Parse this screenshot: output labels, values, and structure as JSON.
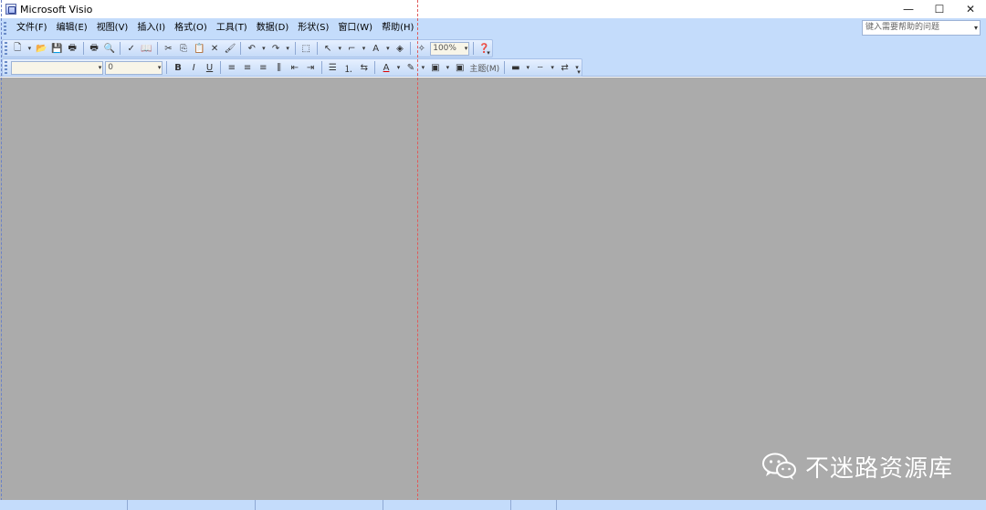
{
  "window": {
    "title": "Microsoft Visio",
    "controls": {
      "minimize": "—",
      "maximize": "☐",
      "close": "✕"
    }
  },
  "menubar": {
    "items": [
      {
        "label": "文件(F)"
      },
      {
        "label": "编辑(E)"
      },
      {
        "label": "视图(V)"
      },
      {
        "label": "插入(I)"
      },
      {
        "label": "格式(O)"
      },
      {
        "label": "工具(T)"
      },
      {
        "label": "数据(D)"
      },
      {
        "label": "形状(S)"
      },
      {
        "label": "窗口(W)"
      },
      {
        "label": "帮助(H)"
      }
    ],
    "help_search": {
      "placeholder": "键入需要帮助的问题",
      "arrow": "▾"
    }
  },
  "toolbar_standard": {
    "icons": [
      "new-icon",
      "open-icon",
      "save-icon",
      "print-icon",
      "print-preview-icon",
      "spelling-icon",
      "research-icon",
      "cut-icon",
      "copy-icon",
      "paste-icon",
      "delete-icon",
      "format-painter-icon",
      "undo-icon",
      "redo-icon",
      "shapes-icon",
      "pointer-tool-icon",
      "connector-tool-icon",
      "text-tool-icon",
      "stencil-icon",
      "connection-point-icon",
      "help-icon"
    ],
    "glyphs": {
      "new": "🗋",
      "open": "📂",
      "save": "💾",
      "print": "🖶",
      "preview": "🔍",
      "spell": "✓",
      "research": "📖",
      "cut": "✂",
      "copy": "⎘",
      "paste": "📋",
      "delete": "✕",
      "painter": "🖌",
      "undo": "↶",
      "redo": "↷",
      "shapes": "⬚",
      "pointer": "↖",
      "connector": "⌐",
      "text": "A",
      "stencil": "◈",
      "connpoint": "✧",
      "help": "❓",
      "dropdown": "▾"
    },
    "zoom_value": "100%"
  },
  "toolbar_formatting": {
    "font_value": "",
    "size_value": "0",
    "glyphs": {
      "bold": "B",
      "italic": "I",
      "underline": "U",
      "align_left": "≡",
      "align_center": "≡",
      "align_right": "≡",
      "justify": "⫼",
      "indent_dec": "⇤",
      "indent_inc": "⇥",
      "bullets": "☰",
      "num_list": "⒈",
      "dec_list": "⇆",
      "font_color": "A",
      "line_color": "✎",
      "fill_color": "▣",
      "line_weight": "▬",
      "line_pattern": "┄",
      "line_ends": "⇄",
      "dropdown": "▾"
    },
    "theme_label": "主题(M)"
  },
  "watermark": {
    "text": "不迷路资源库"
  }
}
